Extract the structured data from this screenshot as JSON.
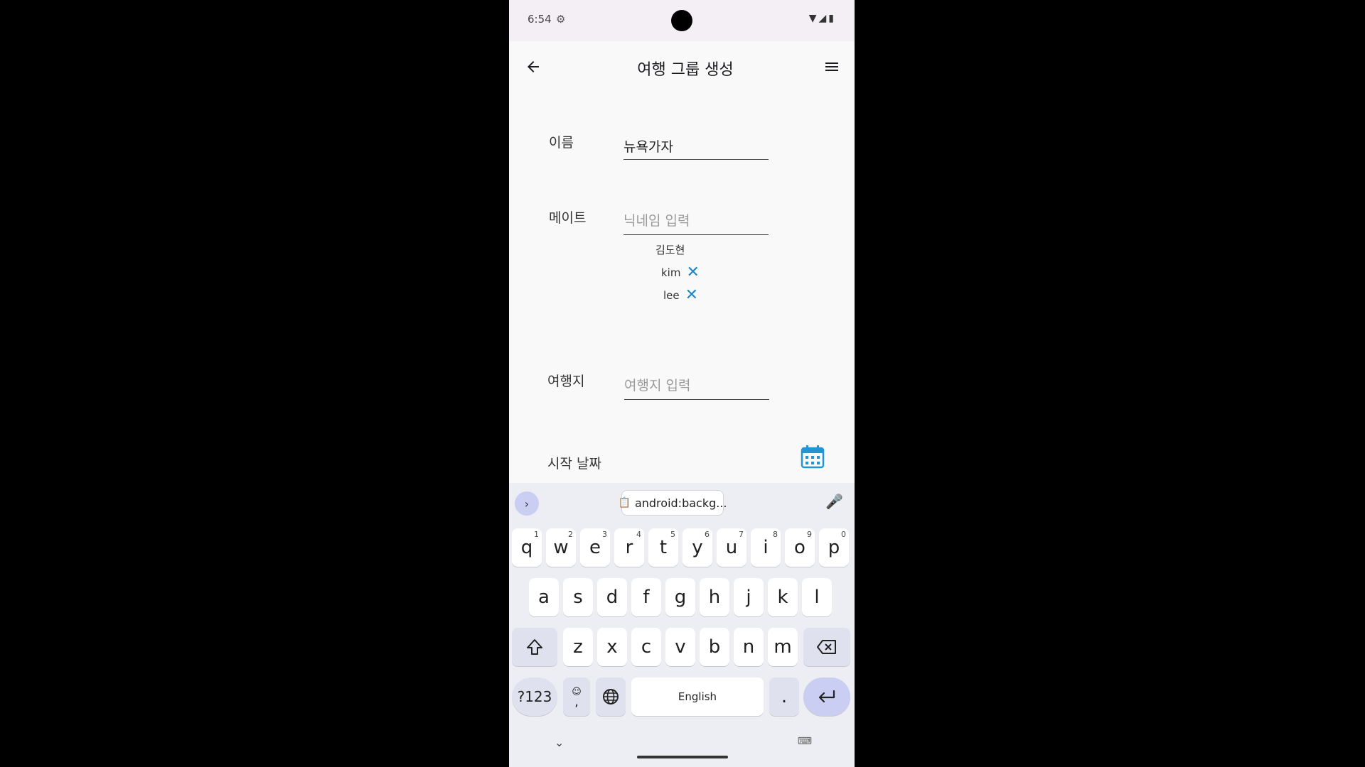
{
  "status_bar": {
    "time": "6:54"
  },
  "app_bar": {
    "title": "여행 그룹 생성"
  },
  "form": {
    "name": {
      "label": "이름",
      "value": "뉴욕가자"
    },
    "mate": {
      "label": "메이트",
      "placeholder": "닉네임 입력",
      "members": [
        {
          "name": "김도현",
          "removable": false
        },
        {
          "name": "kim",
          "removable": true
        },
        {
          "name": "lee",
          "removable": true
        }
      ]
    },
    "destination": {
      "label": "여행지",
      "placeholder": "여행지 입력"
    },
    "start_date": {
      "label": "시작 날짜"
    }
  },
  "keyboard": {
    "clipboard_chip": "android:backg...",
    "row1": [
      {
        "k": "q",
        "h": "1"
      },
      {
        "k": "w",
        "h": "2"
      },
      {
        "k": "e",
        "h": "3"
      },
      {
        "k": "r",
        "h": "4"
      },
      {
        "k": "t",
        "h": "5"
      },
      {
        "k": "y",
        "h": "6"
      },
      {
        "k": "u",
        "h": "7"
      },
      {
        "k": "i",
        "h": "8"
      },
      {
        "k": "o",
        "h": "9"
      },
      {
        "k": "p",
        "h": "0"
      }
    ],
    "row2": [
      "a",
      "s",
      "d",
      "f",
      "g",
      "h",
      "j",
      "k",
      "l"
    ],
    "row3": [
      "z",
      "x",
      "c",
      "v",
      "b",
      "n",
      "m"
    ],
    "sym_label": "?123",
    "comma_label": ",",
    "space_label": "English",
    "period_label": ".",
    "accent_color": "#c9cef2"
  }
}
